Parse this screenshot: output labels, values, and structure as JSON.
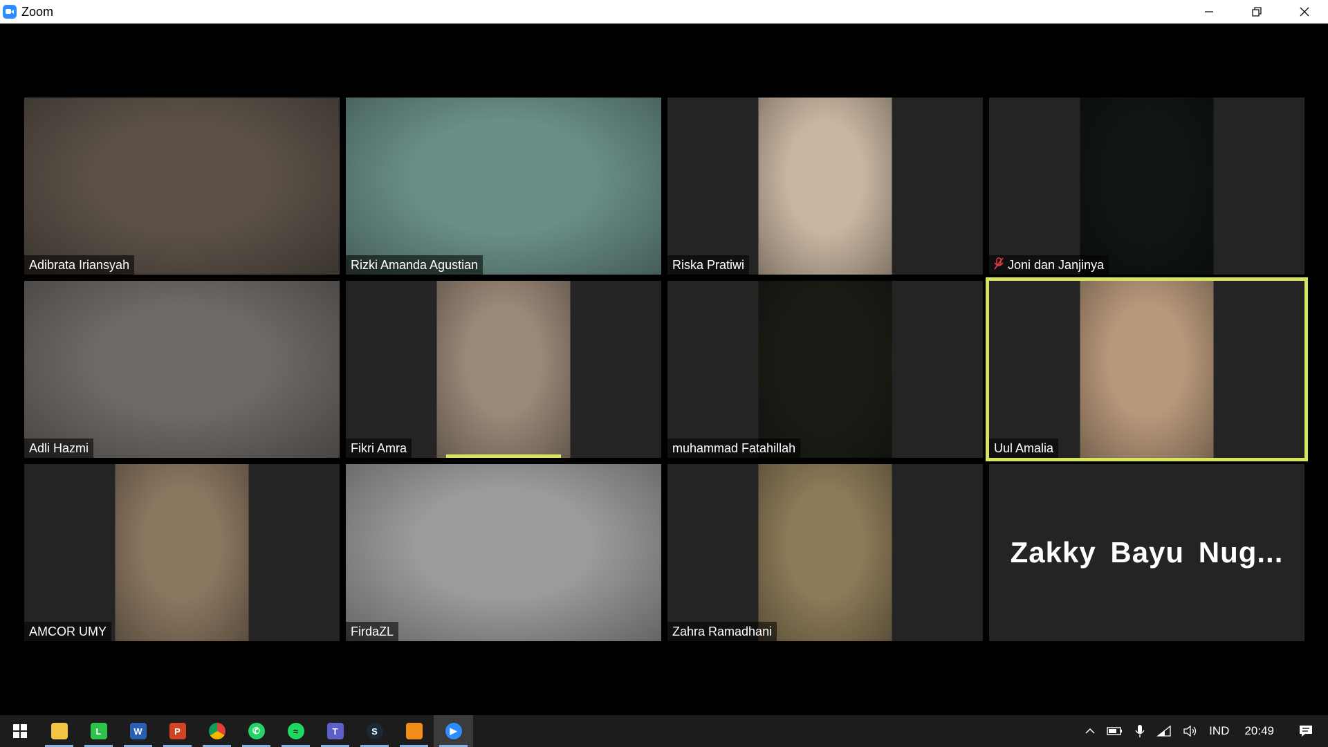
{
  "window": {
    "title": "Zoom"
  },
  "participants": [
    {
      "name": "Adibrata Iriansyah",
      "video": "full",
      "bg": "#5b5148",
      "muted": false
    },
    {
      "name": "Rizki Amanda Agustian",
      "video": "full",
      "bg": "#6a8f88",
      "muted": false
    },
    {
      "name": "Riska Pratiwi",
      "video": "center",
      "bg": "#c9b6a1",
      "muted": false
    },
    {
      "name": "Joni dan Janjinya",
      "video": "center",
      "bg": "#101612",
      "muted": true
    },
    {
      "name": "Adli Hazmi",
      "video": "full",
      "bg": "#6e6966",
      "muted": false
    },
    {
      "name": "Fikri Amra",
      "video": "center",
      "bg": "#9a8878",
      "muted": false,
      "speaking": true
    },
    {
      "name": "muhammad Fatahillah",
      "video": "center",
      "bg": "#1a1d16",
      "muted": false
    },
    {
      "name": "Uul Amalia",
      "video": "center",
      "bg": "#b8987b",
      "muted": false,
      "active_speaker": true
    },
    {
      "name": "AMCOR UMY",
      "video": "center",
      "bg": "#8b7760",
      "muted": false
    },
    {
      "name": "FirdaZL",
      "video": "full",
      "bg": "#9c9a9c",
      "muted": false
    },
    {
      "name": "Zahra Ramadhani",
      "video": "center",
      "bg": "#8c7a58",
      "muted": false
    },
    {
      "name": "Zakky Bayu Nug...",
      "video": "none",
      "bg": "#242424",
      "muted": false
    }
  ],
  "taskbar": {
    "apps": [
      {
        "icon": "windows-start-icon",
        "running": false
      },
      {
        "icon": "file-explorer-icon",
        "running": true
      },
      {
        "icon": "line-app-icon",
        "running": true
      },
      {
        "icon": "word-icon",
        "running": true
      },
      {
        "icon": "powerpoint-icon",
        "running": true
      },
      {
        "icon": "chrome-icon",
        "running": true
      },
      {
        "icon": "whatsapp-icon",
        "running": true
      },
      {
        "icon": "spotify-icon",
        "running": true
      },
      {
        "icon": "teams-icon",
        "running": true
      },
      {
        "icon": "steam-icon",
        "running": true
      },
      {
        "icon": "orange-app-icon",
        "running": true
      },
      {
        "icon": "zoom-taskbar-icon",
        "running": true,
        "active": true
      }
    ],
    "tray": {
      "language": "IND",
      "time": "20:49"
    }
  },
  "colors": {
    "active_speaker_border": "#d6e55c",
    "tile_bg": "#242424",
    "zoom_blue": "#2d8cff"
  }
}
